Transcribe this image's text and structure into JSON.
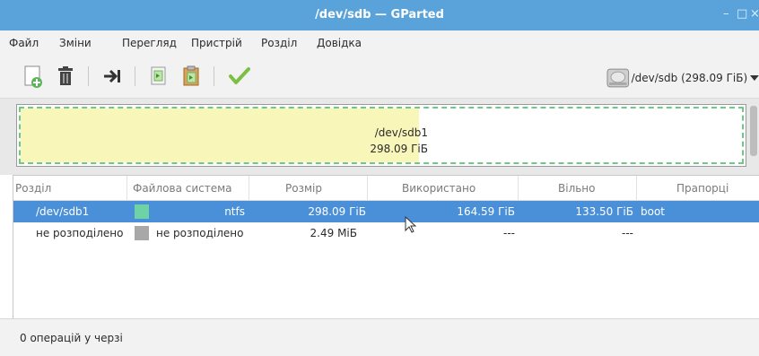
{
  "window": {
    "title": "/dev/sdb — GParted",
    "minimize": "–",
    "maximize": "□",
    "close": "×"
  },
  "menubar": {
    "items": [
      "Файл",
      "Зміни",
      "Перегляд",
      "Пристрій",
      "Розділ",
      "Довідка"
    ]
  },
  "toolbar": {
    "icons": [
      "new-partition-icon",
      "delete-icon",
      "resize-move-icon",
      "copy-icon",
      "paste-icon",
      "apply-icon"
    ],
    "device_selector": {
      "label": "/dev/sdb (298.09 ГіБ)"
    }
  },
  "partition_map": {
    "name": "/dev/sdb1",
    "size": "298.09 ГіБ",
    "used_fraction": 0.552,
    "used_color": "#f9f6b9",
    "border_color": "#6cc987"
  },
  "table": {
    "columns": [
      "Розділ",
      "Файлова система",
      "Розмір",
      "Використано",
      "Вільно",
      "Прапорці"
    ],
    "rows": [
      {
        "partition": "/dev/sdb1",
        "filesystem": "ntfs",
        "fs_color": "#6fd2a6",
        "size": "298.09 ГіБ",
        "used": "164.59 ГіБ",
        "free": "133.50 ГіБ",
        "flags": "boot",
        "selected": true
      },
      {
        "partition": "не розподілено",
        "filesystem": "не розподілено",
        "fs_color": "#a8a8a8",
        "size": "2.49 МіБ",
        "used": "---",
        "free": "---",
        "flags": "",
        "selected": false
      }
    ]
  },
  "status": {
    "text": "0 операцій у черзі"
  },
  "colors": {
    "titlebar": "#5aa3da",
    "selection": "#4a90d9"
  }
}
